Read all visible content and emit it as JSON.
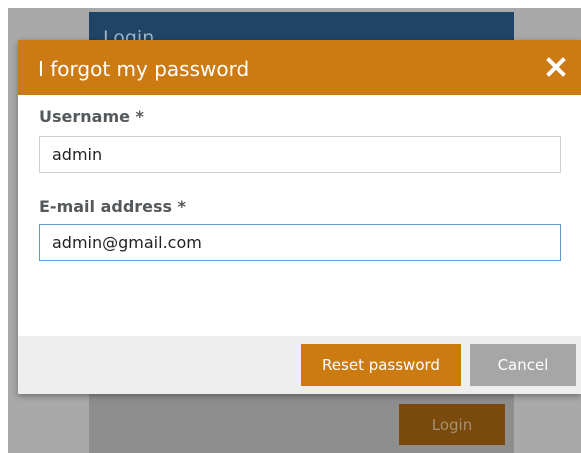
{
  "background": {
    "login_title": "Login",
    "login_button_label": "Login"
  },
  "dialog": {
    "title": "I forgot my password",
    "close_icon": "close-icon",
    "username": {
      "label": "Username *",
      "value": "admin"
    },
    "email": {
      "label": "E-mail address *",
      "value": "admin@gmail.com"
    },
    "buttons": {
      "reset": "Reset password",
      "cancel": "Cancel"
    }
  },
  "colors": {
    "accent": "#cc7a12",
    "header_blue": "#1f4466",
    "overlay": "#a9a9a9",
    "cancel_gray": "#a6a6a6",
    "focus_border": "#5b9bd5"
  }
}
